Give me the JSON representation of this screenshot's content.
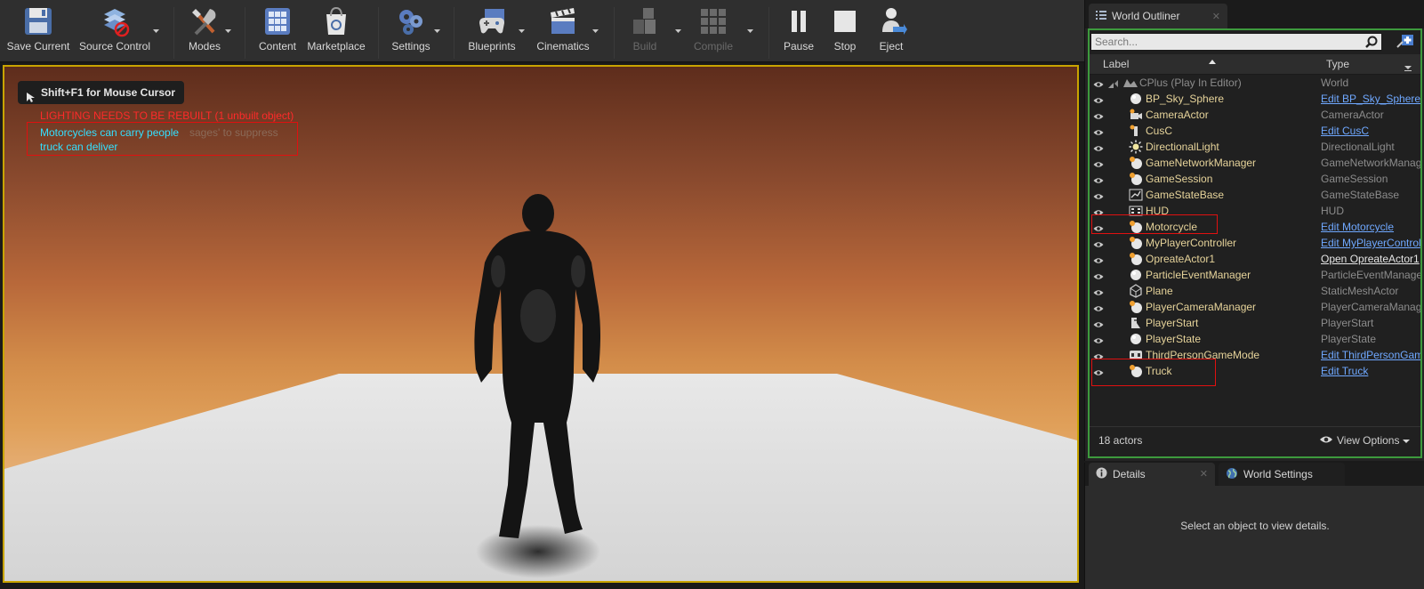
{
  "toolbar": {
    "items": [
      {
        "label": "Save Current",
        "icon": "floppy-disk-icon",
        "disabled": false
      },
      {
        "label": "Source Control",
        "icon": "source-control-icon",
        "disabled": false
      },
      {
        "label": "Modes",
        "icon": "modes-tools-icon",
        "disabled": false
      },
      {
        "label": "Content",
        "icon": "content-grid-icon",
        "disabled": false
      },
      {
        "label": "Marketplace",
        "icon": "marketplace-bag-icon",
        "disabled": false
      },
      {
        "label": "Settings",
        "icon": "settings-gears-icon",
        "disabled": false
      },
      {
        "label": "Blueprints",
        "icon": "blueprints-gamepad-icon",
        "disabled": false
      },
      {
        "label": "Cinematics",
        "icon": "clapperboard-icon",
        "disabled": false
      },
      {
        "label": "Build",
        "icon": "build-blocks-icon",
        "disabled": true
      },
      {
        "label": "Compile",
        "icon": "compile-cubes-icon",
        "disabled": true
      },
      {
        "label": "Pause",
        "icon": "pause-icon",
        "disabled": false
      },
      {
        "label": "Stop",
        "icon": "stop-icon",
        "disabled": false
      },
      {
        "label": "Eject",
        "icon": "eject-person-icon",
        "disabled": false
      }
    ]
  },
  "viewport": {
    "mouse_hint": "Shift+F1 for Mouse Cursor",
    "lighting_warning": "LIGHTING NEEDS TO BE REBUILT (1 unbuilt object)",
    "background_hint_fragment": "sages' to suppress",
    "messages": [
      "Motorcycles can carry people",
      "truck can deliver"
    ]
  },
  "outliner": {
    "tab_title": "World Outliner",
    "search_placeholder": "Search...",
    "col_label": "Label",
    "col_type": "Type",
    "rows": [
      {
        "label": "CPlus (Play In Editor)",
        "type": "World",
        "type_style": "plain",
        "icon": "world-icon",
        "is_world": true
      },
      {
        "label": "BP_Sky_Sphere",
        "type": "Edit BP_Sky_Sphere",
        "type_style": "link",
        "icon": "sphere-icon"
      },
      {
        "label": "CameraActor",
        "type": "CameraActor",
        "type_style": "plain",
        "icon": "camera-icon"
      },
      {
        "label": "CusC",
        "type": "Edit CusC",
        "type_style": "link",
        "icon": "actor-pawn-icon"
      },
      {
        "label": "DirectionalLight",
        "type": "DirectionalLight",
        "type_style": "plain",
        "icon": "sun-light-icon"
      },
      {
        "label": "GameNetworkManager",
        "type": "GameNetworkManager",
        "type_style": "plain",
        "icon": "actor-sphere-icon"
      },
      {
        "label": "GameSession",
        "type": "GameSession",
        "type_style": "plain",
        "icon": "actor-sphere-icon"
      },
      {
        "label": "GameStateBase",
        "type": "GameStateBase",
        "type_style": "plain",
        "icon": "graph-icon"
      },
      {
        "label": "HUD",
        "type": "HUD",
        "type_style": "plain",
        "icon": "hud-icon"
      },
      {
        "label": "Motorcycle",
        "type": "Edit Motorcycle",
        "type_style": "link",
        "icon": "actor-sphere-icon"
      },
      {
        "label": "MyPlayerController",
        "type": "Edit MyPlayerController",
        "type_style": "link",
        "icon": "actor-sphere-icon"
      },
      {
        "label": "OpreateActor1",
        "type": "Open OpreateActor1",
        "type_style": "open",
        "icon": "actor-sphere-icon"
      },
      {
        "label": "ParticleEventManager",
        "type": "ParticleEventManager",
        "type_style": "plain",
        "icon": "sphere-icon"
      },
      {
        "label": "Plane",
        "type": "StaticMeshActor",
        "type_style": "plain",
        "icon": "static-mesh-icon"
      },
      {
        "label": "PlayerCameraManager",
        "type": "PlayerCameraManager",
        "type_style": "plain",
        "icon": "actor-sphere-icon"
      },
      {
        "label": "PlayerStart",
        "type": "PlayerStart",
        "type_style": "plain",
        "icon": "player-start-icon"
      },
      {
        "label": "PlayerState",
        "type": "PlayerState",
        "type_style": "plain",
        "icon": "sphere-icon"
      },
      {
        "label": "ThirdPersonGameMode",
        "type": "Edit ThirdPersonGameMode",
        "type_style": "link",
        "icon": "game-mode-icon"
      },
      {
        "label": "Truck",
        "type": "Edit Truck",
        "type_style": "link",
        "icon": "actor-sphere-icon"
      }
    ],
    "actor_count": "18 actors",
    "view_options": "View Options"
  },
  "details": {
    "tab_details": "Details",
    "tab_world_settings": "World Settings",
    "empty_message": "Select an object to view details."
  },
  "colors": {
    "selection_border": "#e01010",
    "viewport_border": "#c8a400",
    "outliner_focus_border": "#3d9a3d",
    "message_cyan": "#33e0ff",
    "warning_red": "#ff2a2a",
    "link_blue": "#6fa8ff"
  }
}
